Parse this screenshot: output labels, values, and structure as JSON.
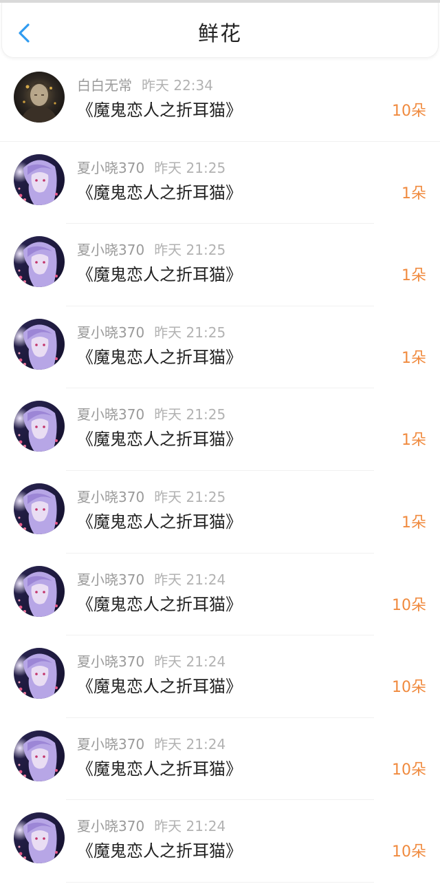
{
  "header": {
    "title": "鲜花",
    "back_icon": "chevron-left-icon",
    "accent_color": "#2f9bf0"
  },
  "records": [
    {
      "user": "白白无常",
      "time": "昨天 22:34",
      "book": "《魔鬼恋人之折耳猫》",
      "count": "10朵",
      "avatar": "dark-portrait"
    },
    {
      "user": "夏小晓370",
      "time": "昨天 21:25",
      "book": "《魔鬼恋人之折耳猫》",
      "count": "1朵",
      "avatar": "purple-hair-portrait"
    },
    {
      "user": "夏小晓370",
      "time": "昨天 21:25",
      "book": "《魔鬼恋人之折耳猫》",
      "count": "1朵",
      "avatar": "purple-hair-portrait"
    },
    {
      "user": "夏小晓370",
      "time": "昨天 21:25",
      "book": "《魔鬼恋人之折耳猫》",
      "count": "1朵",
      "avatar": "purple-hair-portrait"
    },
    {
      "user": "夏小晓370",
      "time": "昨天 21:25",
      "book": "《魔鬼恋人之折耳猫》",
      "count": "1朵",
      "avatar": "purple-hair-portrait"
    },
    {
      "user": "夏小晓370",
      "time": "昨天 21:25",
      "book": "《魔鬼恋人之折耳猫》",
      "count": "1朵",
      "avatar": "purple-hair-portrait"
    },
    {
      "user": "夏小晓370",
      "time": "昨天 21:24",
      "book": "《魔鬼恋人之折耳猫》",
      "count": "10朵",
      "avatar": "purple-hair-portrait"
    },
    {
      "user": "夏小晓370",
      "time": "昨天 21:24",
      "book": "《魔鬼恋人之折耳猫》",
      "count": "10朵",
      "avatar": "purple-hair-portrait"
    },
    {
      "user": "夏小晓370",
      "time": "昨天 21:24",
      "book": "《魔鬼恋人之折耳猫》",
      "count": "10朵",
      "avatar": "purple-hair-portrait"
    },
    {
      "user": "夏小晓370",
      "time": "昨天 21:24",
      "book": "《魔鬼恋人之折耳猫》",
      "count": "10朵",
      "avatar": "purple-hair-portrait"
    }
  ]
}
